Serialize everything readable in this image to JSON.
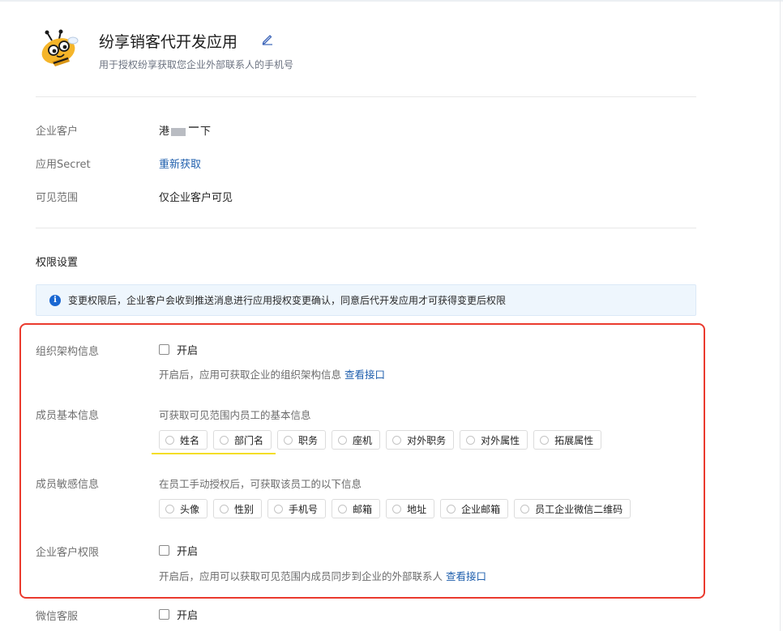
{
  "app": {
    "title": "纷享销客代开发应用",
    "description": "用于授权纷享获取您企业外部联系人的手机号",
    "edit_icon": "pencil-icon",
    "logo_icon": "bee-mascot-icon"
  },
  "basic_info": {
    "enterprise_customer": {
      "label": "企业客户",
      "value_prefix": "港",
      "value_suffix": "下"
    },
    "app_secret": {
      "label": "应用Secret",
      "action": "重新获取"
    },
    "visibility": {
      "label": "可见范围",
      "value": "仅企业客户可见"
    }
  },
  "permissions": {
    "title": "权限设置",
    "notice": "变更权限后，企业客户会收到推送消息进行应用授权变更确认，同意后代开发应用才可获得变更后权限",
    "notice_icon": "info-icon",
    "org_structure": {
      "label": "组织架构信息",
      "toggle_label": "开启",
      "hint": "开启后，应用可获取企业的组织架构信息",
      "link": "查看接口"
    },
    "member_basic": {
      "label": "成员基本信息",
      "hint": "可获取可见范围内员工的基本信息",
      "options": [
        "姓名",
        "部门名",
        "职务",
        "座机",
        "对外职务",
        "对外属性",
        "拓展属性"
      ]
    },
    "member_sensitive": {
      "label": "成员敏感信息",
      "hint": "在员工手动授权后，可获取该员工的以下信息",
      "options": [
        "头像",
        "性别",
        "手机号",
        "邮箱",
        "地址",
        "企业邮箱",
        "员工企业微信二维码"
      ]
    },
    "customer_permission": {
      "label": "企业客户权限",
      "toggle_label": "开启",
      "hint": "开启后，应用可以获取可见范围内成员同步到企业的外部联系人",
      "link": "查看接口"
    },
    "wechat_service": {
      "label": "微信客服",
      "toggle_label": "开启"
    }
  },
  "colors": {
    "link": "#1f5fad",
    "highlight_box": "#ea3a2e",
    "highlight_underline": "#f4de27",
    "info_icon": "#1967d2"
  }
}
